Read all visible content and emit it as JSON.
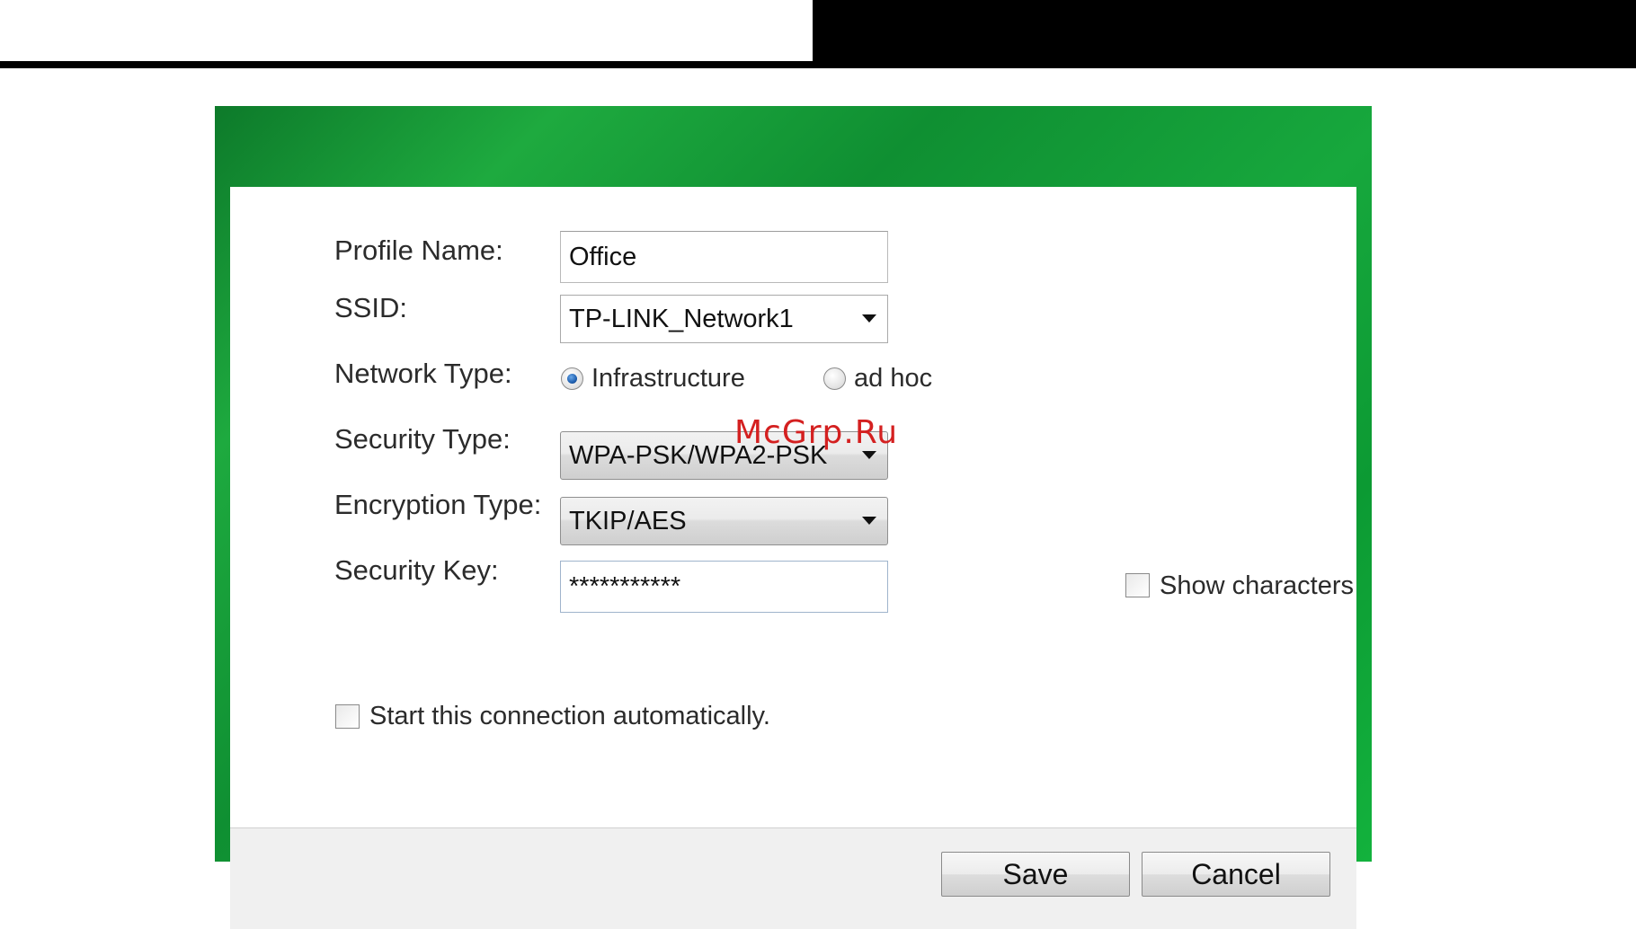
{
  "dialog": {
    "form": {
      "profile_name": {
        "label": "Profile Name:",
        "value": "Office"
      },
      "ssid": {
        "label": "SSID:",
        "value": "TP-LINK_Network1"
      },
      "network_type": {
        "label": "Network Type:",
        "options": [
          {
            "label": "Infrastructure",
            "selected": true
          },
          {
            "label": "ad hoc",
            "selected": false
          }
        ]
      },
      "security_type": {
        "label": "Security Type:",
        "value": "WPA-PSK/WPA2-PSK"
      },
      "encryption_type": {
        "label": "Encryption Type:",
        "value": "TKIP/AES"
      },
      "security_key": {
        "label": "Security Key:",
        "value": "***********"
      },
      "show_characters": {
        "label": "Show characters",
        "checked": false
      },
      "auto_connect": {
        "label": "Start this connection automatically.",
        "checked": false
      }
    },
    "buttons": {
      "save": "Save",
      "cancel": "Cancel"
    }
  },
  "watermark": "McGrp.Ru",
  "colors": {
    "frame_green": "#13a83a",
    "radio_dot_blue": "#1f5fb0",
    "watermark_red": "#d42020"
  }
}
